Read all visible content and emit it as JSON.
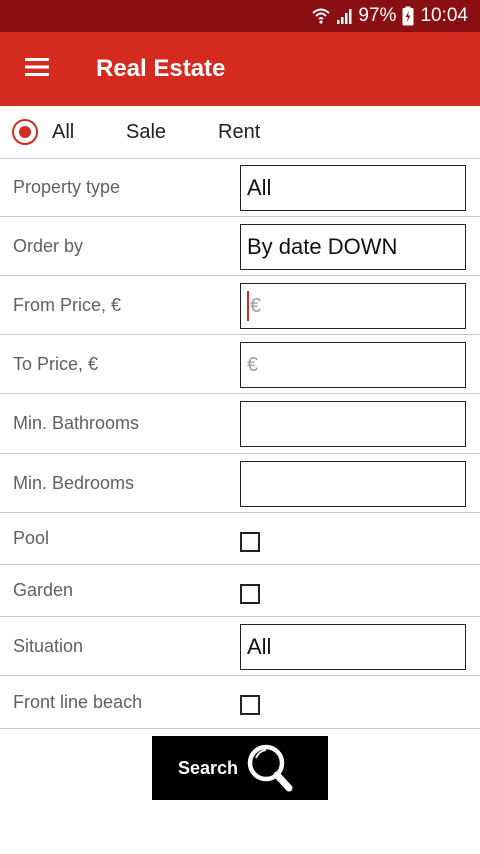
{
  "status_bar": {
    "battery": "97%",
    "time": "10:04",
    "icons": [
      "wifi-icon",
      "signal-icon",
      "battery-charging-icon"
    ]
  },
  "app_bar": {
    "title": "Real Estate",
    "menu_icon": "hamburger-menu-icon",
    "color": "#d42a1f",
    "status_color": "#8a0f12"
  },
  "listing_type": {
    "options": [
      {
        "label": "All",
        "selected": true
      },
      {
        "label": "Sale",
        "selected": false
      },
      {
        "label": "Rent",
        "selected": false
      }
    ]
  },
  "form": {
    "property_type": {
      "label": "Property type",
      "value": "All"
    },
    "order_by": {
      "label": "Order by",
      "value": "By date DOWN"
    },
    "from_price": {
      "label": "From Price, €",
      "placeholder": "€"
    },
    "to_price": {
      "label": "To Price, €",
      "placeholder": "€"
    },
    "min_bathrooms": {
      "label": "Min. Bathrooms",
      "value": ""
    },
    "min_bedrooms": {
      "label": "Min. Bedrooms",
      "value": ""
    },
    "pool": {
      "label": "Pool",
      "checked": false
    },
    "garden": {
      "label": "Garden",
      "checked": false
    },
    "situation": {
      "label": "Situation",
      "value": "All"
    },
    "front_line_beach": {
      "label": "Front line beach",
      "checked": false
    }
  },
  "search_button": {
    "label": "Search",
    "icon": "magnifier-icon"
  }
}
